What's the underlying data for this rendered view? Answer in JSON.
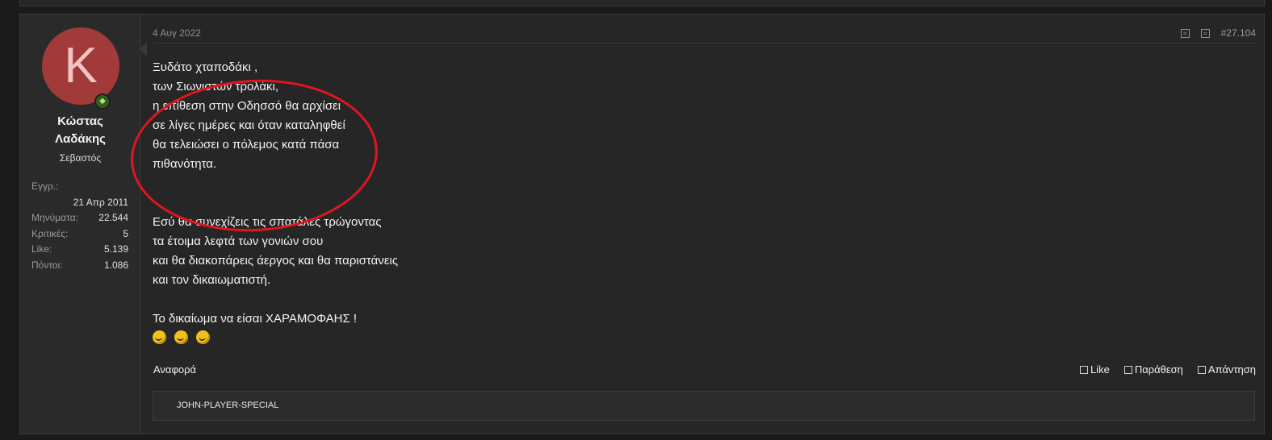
{
  "user": {
    "avatar_letter": "K",
    "name_line1": "Κώστας",
    "name_line2": "Λαδάκης",
    "title": "Σεβαστός",
    "avatar_color": "#a23a3a",
    "stats": {
      "joined_label": "Εγγρ.:",
      "joined_value": "21 Απρ 2011",
      "messages_label": "Μηνύματα:",
      "messages_value": "22.544",
      "reviews_label": "Κριτικές:",
      "reviews_value": "5",
      "likes_label": "Like:",
      "likes_value": "5.139",
      "points_label": "Πόντοι:",
      "points_value": "1.086"
    }
  },
  "post": {
    "date": "4 Αυγ 2022",
    "number": "#27.104",
    "lines_block1": [
      "Ξυδάτο χταποδάκι ,",
      "των Σιωνιστών τρολάκι,",
      "η επίθεση στην Οδησσό θα αρχίσει",
      "σε λίγες ημέρες και όταν καταληφθεί",
      "θα τελειώσει ο πόλεμος κατά πάσα",
      "πιθανότητα."
    ],
    "lines_block2": [
      "Εσύ θα συνεχίζεις τις σπατάλες τρώγοντας",
      "τα έτοιμα λεφτά των γονιών σου",
      "και θα διακοπάρεις άεργος και θα παριστάνεις",
      "και τον δικαιωματιστή."
    ],
    "lines_block3": [
      "Το δικαίωμα να είσαι ΧΑΡΑΜΟΦΑΗΣ !"
    ],
    "annotation_color": "#e0161e"
  },
  "actions": {
    "report": "Αναφορά",
    "like": "Like",
    "quote": "Παράθεση",
    "reply": "Απάντηση"
  },
  "signature": {
    "text": "JOHN-PLAYER-SPECIAL"
  }
}
